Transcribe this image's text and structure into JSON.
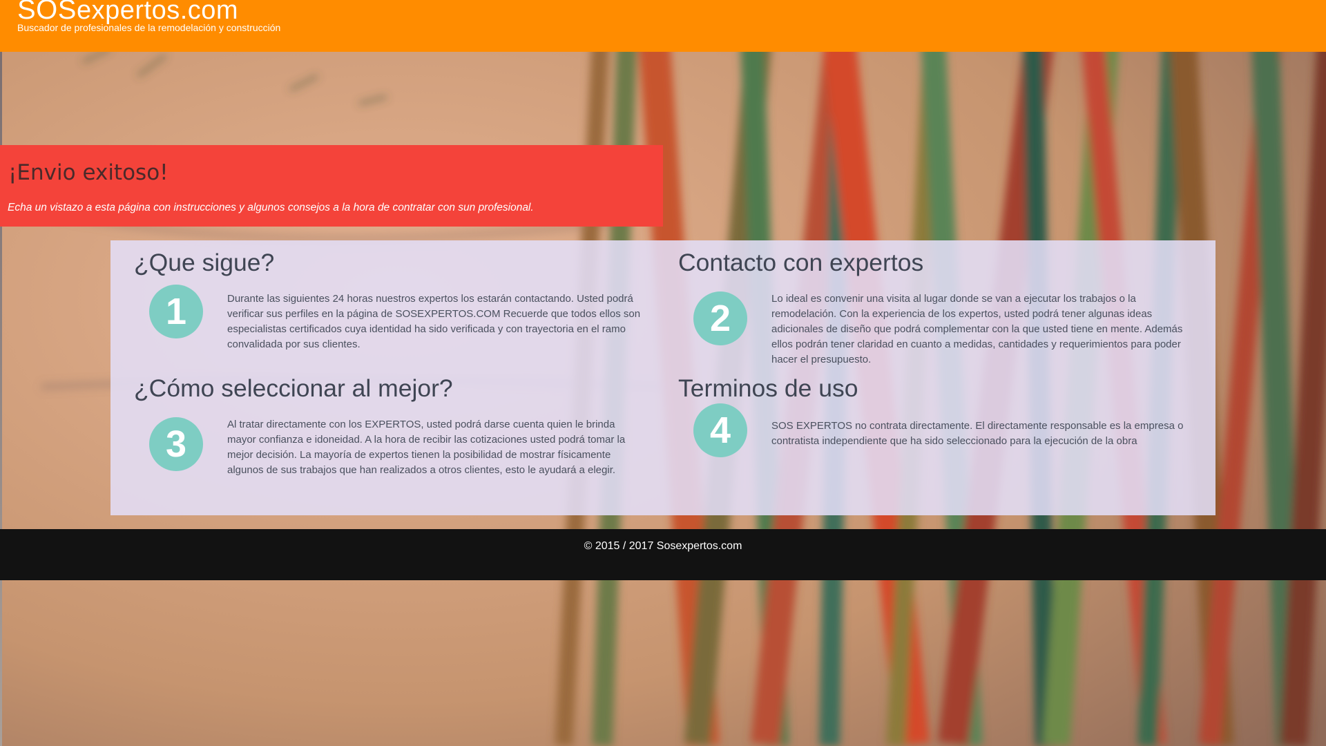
{
  "header": {
    "brand_strong": "SOS",
    "brand_rest": "expertos.com",
    "tagline": "Buscador de profesionales de la remodelación y construcción"
  },
  "banner": {
    "title": "¡Envio exitoso!",
    "text": "Echa un vistazo a esta página con instrucciones y algunos consejos a la hora de contratar con sun profesional."
  },
  "sections": [
    {
      "title": "¿Que sigue?",
      "number": "1",
      "text": "Durante las siguientes 24 horas nuestros expertos los estarán contactando. Usted podrá verificar sus perfiles en la página de SOSEXPERTOS.COM Recuerde que todos ellos son especialistas certificados cuya identidad ha sido verificada y con trayectoria en el ramo convalidada por sus clientes."
    },
    {
      "title": "Contacto con expertos",
      "number": "2",
      "text": "Lo ideal es convenir una visita al lugar donde se van a ejecutar los trabajos o la remodelación. Con la experiencia de los expertos, usted podrá tener algunas ideas adicionales de diseño que podrá complementar con la que usted tiene en mente. Además ellos podrán tener claridad en cuanto a medidas, cantidades y requerimientos para poder hacer el presupuesto."
    },
    {
      "title": "¿Cómo seleccionar al mejor?",
      "number": "3",
      "text": "Al tratar directamente con los EXPERTOS, usted podrá darse cuenta quien le brinda mayor confianza e idoneidad. A la hora de recibir las cotizaciones usted podrá tomar la mejor decisión. La mayoría de expertos tienen la posibilidad de mostrar físicamente algunos de sus trabajos que han realizados a otros clientes, esto le ayudará a elegir."
    },
    {
      "title": "Terminos de uso",
      "number": "4",
      "text": "SOS EXPERTOS no contrata directamente. El directamente responsable es la empresa o contratista independiente que ha sido seleccionado para la ejecución de la obra"
    }
  ],
  "footer": {
    "copyright": "© 2015 / 2017 Sosexpertos.com"
  },
  "colors": {
    "header": "#ff8c00",
    "banner": "#f4433a",
    "number_circle": "#7ecdc3",
    "footer": "#121212"
  }
}
